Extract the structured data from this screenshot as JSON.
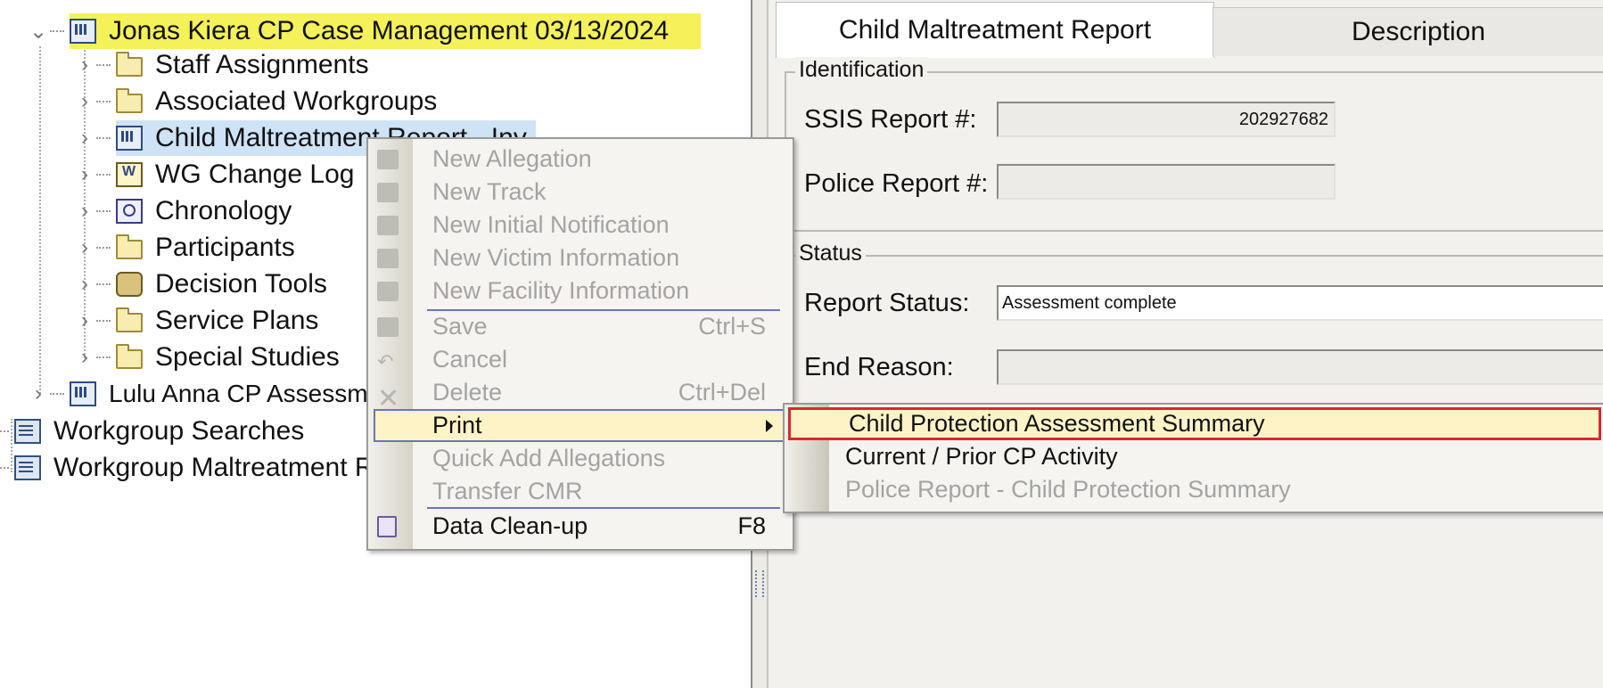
{
  "tree": {
    "case_root": "Jonas Kiera CP Case Management 03/13/2024",
    "children": [
      {
        "label": "Staff Assignments",
        "icon": "folder-icon"
      },
      {
        "label": "Associated Workgroups",
        "icon": "folder-icon"
      },
      {
        "label": "Child Maltreatment Report - Inv",
        "icon": "report-icon"
      },
      {
        "label": "WG Change Log",
        "icon": "log-icon"
      },
      {
        "label": "Chronology",
        "icon": "chronology-icon"
      },
      {
        "label": "Participants",
        "icon": "folder-icon"
      },
      {
        "label": "Decision Tools",
        "icon": "tools-icon"
      },
      {
        "label": "Service Plans",
        "icon": "folder-icon"
      },
      {
        "label": "Special Studies",
        "icon": "folder-icon"
      }
    ],
    "second_case": "Lulu Anna CP Assessment",
    "workgroup_searches": "Workgroup Searches",
    "workgroup_maltreatment": "Workgroup Maltreatment Reports"
  },
  "context_menu": {
    "items": [
      {
        "label": "New Allegation",
        "state": "disabled"
      },
      {
        "label": "New Track",
        "state": "disabled"
      },
      {
        "label": "New Initial Notification",
        "state": "disabled"
      },
      {
        "label": "New Victim Information",
        "state": "disabled"
      },
      {
        "label": "New Facility Information",
        "state": "disabled"
      },
      {
        "label": "Save",
        "shortcut": "Ctrl+S",
        "state": "disabled"
      },
      {
        "label": "Cancel",
        "state": "disabled"
      },
      {
        "label": "Delete",
        "shortcut": "Ctrl+Del",
        "state": "disabled"
      },
      {
        "label": "Print",
        "state": "highlighted"
      },
      {
        "label": "Quick Add Allegations",
        "state": "disabled"
      },
      {
        "label": "Transfer CMR",
        "state": "disabled"
      },
      {
        "label": "Data Clean-up",
        "shortcut": "F8",
        "state": "enabled"
      }
    ]
  },
  "print_submenu": {
    "items": [
      {
        "label": "Child Protection Assessment Summary",
        "state": "highlighted"
      },
      {
        "label": "Current / Prior CP Activity",
        "state": "enabled"
      },
      {
        "label": "Police Report - Child Protection Summary",
        "state": "disabled"
      }
    ]
  },
  "panel": {
    "tabs": [
      "Child Maltreatment Report",
      "Description"
    ],
    "identification_label": "Identification",
    "ssis_label": "SSIS Report #:",
    "ssis_value": "202927682",
    "police_label": "Police Report #:",
    "police_value": "",
    "status_label": "Status",
    "report_status_label": "Report Status:",
    "report_status_value": "Assessment complete",
    "end_reason_label": "End Reason:",
    "end_reason_value": ""
  },
  "colors": {
    "case_highlight": "#f4f15a",
    "menu_highlight": "#fdf3c6",
    "callout_red": "#e0262a"
  }
}
